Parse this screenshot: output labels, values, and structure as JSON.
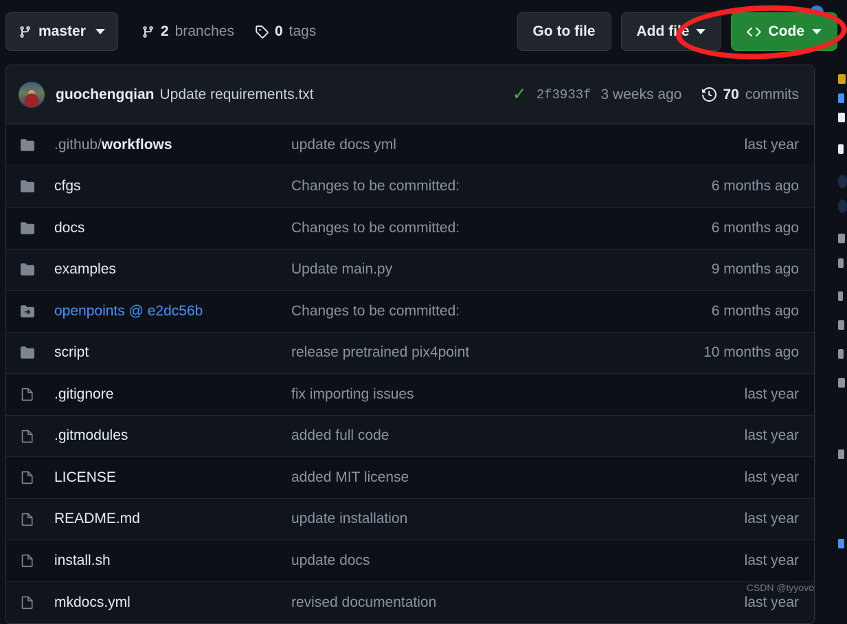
{
  "toolbar": {
    "branch": {
      "label": "master",
      "icon": "branch-icon"
    },
    "branches": {
      "count": "2",
      "label": "branches",
      "icon": "branch-icon"
    },
    "tags": {
      "count": "0",
      "label": "tags",
      "icon": "tag-icon"
    },
    "go_to_file": "Go to file",
    "add_file": "Add file",
    "code": "Code"
  },
  "commit": {
    "author": "guochengqian",
    "message": "Update requirements.txt",
    "status_icon": "check-icon",
    "sha": "2f3933f",
    "age": "3 weeks ago",
    "history_icon": "history-icon",
    "commits_count": "70",
    "commits_label": "commits"
  },
  "files": [
    {
      "type": "folder",
      "icon": "folder-icon",
      "prefix": ".github/",
      "name": "workflows",
      "message": "update docs yml",
      "age": "last year",
      "link": false
    },
    {
      "type": "folder",
      "icon": "folder-icon",
      "prefix": "",
      "name": "cfgs",
      "message": "Changes to be committed:",
      "age": "6 months ago",
      "link": false
    },
    {
      "type": "folder",
      "icon": "folder-icon",
      "prefix": "",
      "name": "docs",
      "message": "Changes to be committed:",
      "age": "6 months ago",
      "link": false
    },
    {
      "type": "folder",
      "icon": "folder-icon",
      "prefix": "",
      "name": "examples",
      "message": "Update main.py",
      "age": "9 months ago",
      "link": false
    },
    {
      "type": "submodule",
      "icon": "submodule-icon",
      "prefix": "",
      "name": "openpoints @ e2dc56b",
      "message": "Changes to be committed:",
      "age": "6 months ago",
      "link": true
    },
    {
      "type": "folder",
      "icon": "folder-icon",
      "prefix": "",
      "name": "script",
      "message": "release pretrained pix4point",
      "age": "10 months ago",
      "link": false
    },
    {
      "type": "file",
      "icon": "file-icon",
      "prefix": "",
      "name": ".gitignore",
      "message": "fix importing issues",
      "age": "last year",
      "link": false
    },
    {
      "type": "file",
      "icon": "file-icon",
      "prefix": "",
      "name": ".gitmodules",
      "message": "added full code",
      "age": "last year",
      "link": false
    },
    {
      "type": "file",
      "icon": "file-icon",
      "prefix": "",
      "name": "LICENSE",
      "message": "added MIT license",
      "age": "last year",
      "link": false
    },
    {
      "type": "file",
      "icon": "file-icon",
      "prefix": "",
      "name": "README.md",
      "message": "update installation",
      "age": "last year",
      "link": false
    },
    {
      "type": "file",
      "icon": "file-icon",
      "prefix": "",
      "name": "install.sh",
      "message": "update docs",
      "age": "last year",
      "link": false
    },
    {
      "type": "file",
      "icon": "file-icon",
      "prefix": "",
      "name": "mkdocs.yml",
      "message": "revised documentation",
      "age": "last year",
      "link": false
    }
  ],
  "annotation": {
    "shape": "ellipse",
    "color": "#f42121",
    "target": "code-button"
  },
  "watermark": "CSDN @tyyovo",
  "colors": {
    "page_bg": "#0d1117",
    "panel_bg": "#161b22",
    "border": "#30363d",
    "accent_green": "#238636",
    "link_blue": "#4493f8",
    "muted": "#8b949e",
    "annotation_red": "#f42121"
  }
}
